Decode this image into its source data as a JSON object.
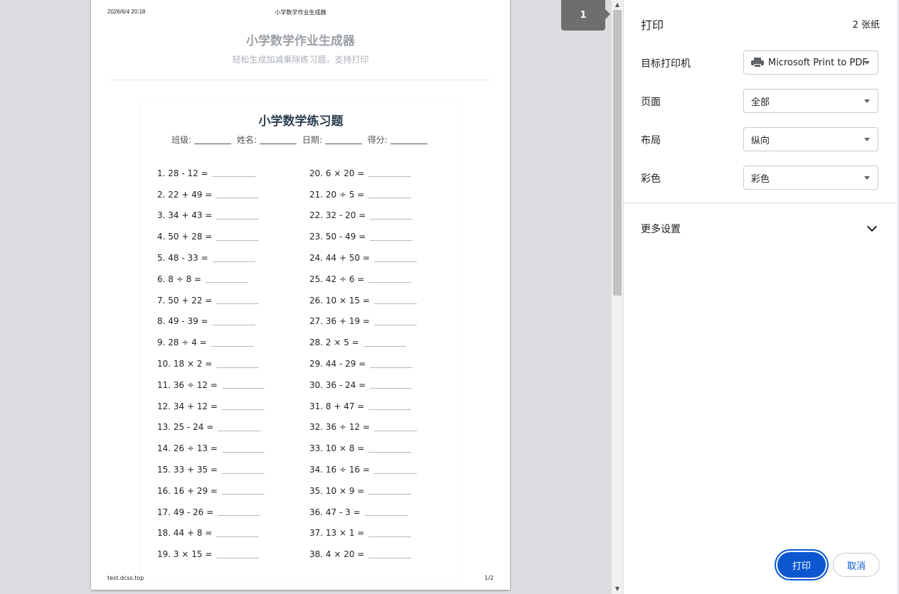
{
  "preview": {
    "header_date": "2026/6/4 20:18",
    "header_title": "小学数学作业生成器",
    "site_title": "小学数学作业生成器",
    "site_subtitle": "轻松生成加减乘除练习题，支持打印",
    "footer_url": "test.dcss.top",
    "footer_page": "1/2",
    "page_indicator": "1"
  },
  "worksheet": {
    "title": "小学数学练习题",
    "fields": [
      "班级:",
      "姓名:",
      "日期:",
      "得分:"
    ],
    "left_questions": [
      "1. 28 - 12 =",
      "2. 22 + 49 =",
      "3. 34 + 43 =",
      "4. 50 + 28 =",
      "5. 48 - 33 =",
      "6. 8 ÷ 8 =",
      "7. 50 + 22 =",
      "8. 49 - 39 =",
      "9. 28 ÷ 4 =",
      "10. 18 × 2 =",
      "11. 36 ÷ 12 =",
      "12. 34 + 12 =",
      "13. 25 - 24 =",
      "14. 26 ÷ 13 =",
      "15. 33 + 35 =",
      "16. 16 + 29 =",
      "17. 49 - 26 =",
      "18. 44 + 8 =",
      "19. 3 × 15 ="
    ],
    "right_questions": [
      "20. 6 × 20 =",
      "21. 20 ÷ 5 =",
      "22. 32 - 20 =",
      "23. 50 - 49 =",
      "24. 44 + 50 =",
      "25. 42 ÷ 6 =",
      "26. 10 × 15 =",
      "27. 36 + 19 =",
      "28. 2 × 5 =",
      "29. 44 - 29 =",
      "30. 36 - 24 =",
      "31. 8 + 47 =",
      "32. 36 ÷ 12 =",
      "33. 10 × 8 =",
      "34. 16 ÷ 16 =",
      "35. 10 × 9 =",
      "36. 47 - 3 =",
      "37. 13 × 1 =",
      "38. 4 × 20 ="
    ]
  },
  "panel": {
    "title": "打印",
    "sheet_count": "2 张纸",
    "destination_label": "目标打印机",
    "destination_value": "Microsoft Print to PDF",
    "pages_label": "页面",
    "pages_value": "全部",
    "layout_label": "布局",
    "layout_value": "纵向",
    "color_label": "彩色",
    "color_value": "彩色",
    "more_settings": "更多设置",
    "print_button": "打印",
    "cancel_button": "取消"
  },
  "colors": {
    "accent": "#0b57d0",
    "worksheet_title": "#2c3e50"
  }
}
